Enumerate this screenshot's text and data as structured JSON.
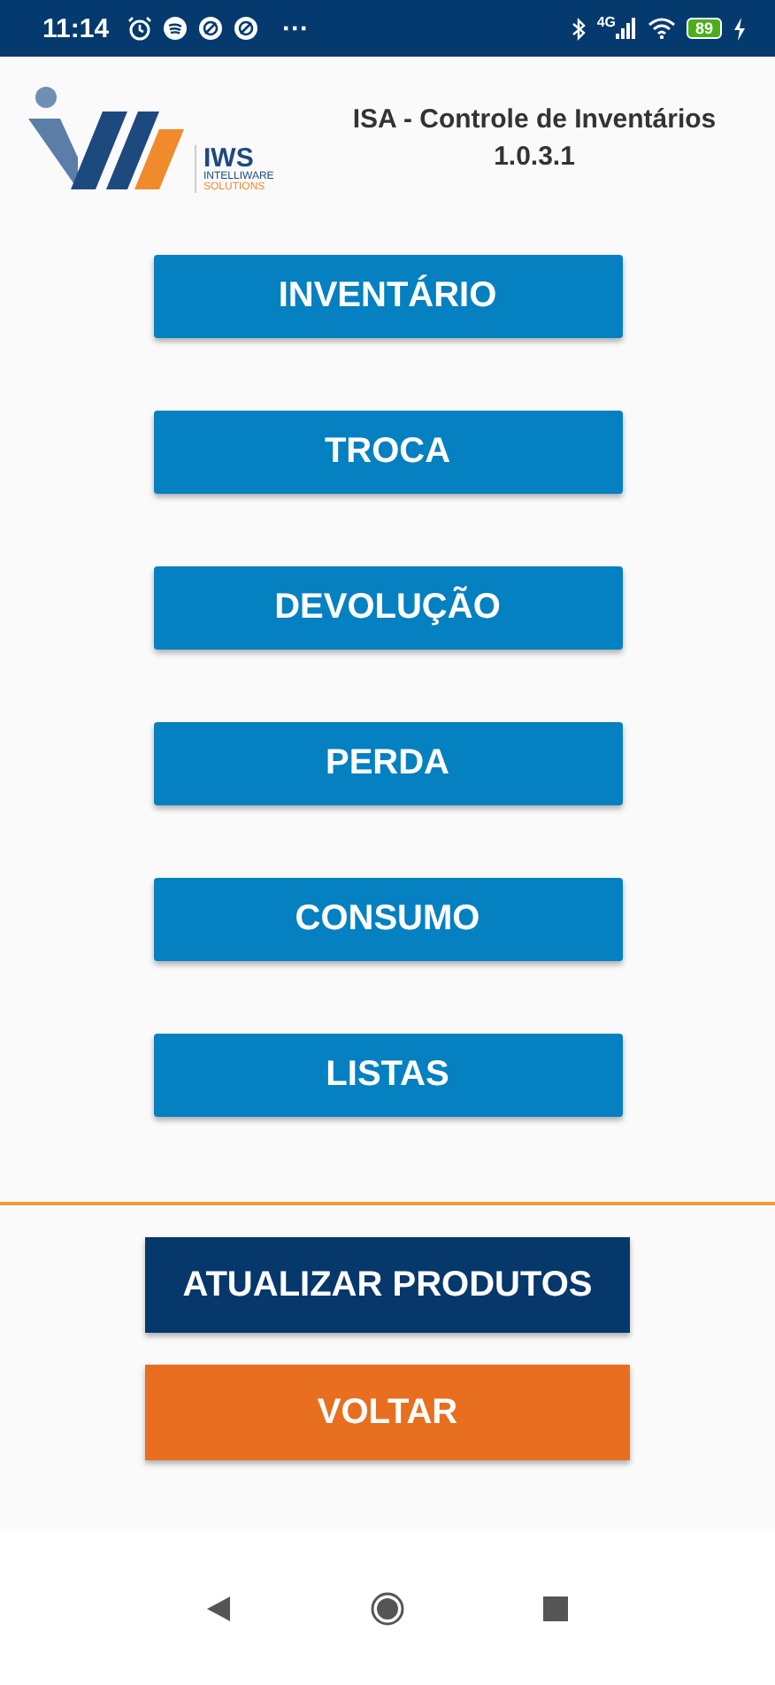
{
  "status_bar": {
    "time": "11:14",
    "more": "···",
    "network": "4G",
    "battery": "89"
  },
  "header": {
    "logo": {
      "name": "IWS",
      "line1": "INTELLIWARE",
      "line2": "SOLUTIONS"
    },
    "title": "ISA - Controle de Inventários",
    "version": "1.0.3.1"
  },
  "menu": [
    {
      "label": "INVENTÁRIO"
    },
    {
      "label": "TROCA"
    },
    {
      "label": "DEVOLUÇÃO"
    },
    {
      "label": "PERDA"
    },
    {
      "label": "CONSUMO"
    },
    {
      "label": "LISTAS"
    }
  ],
  "footer_buttons": [
    {
      "label": "ATUALIZAR PRODUTOS",
      "kind": "primary"
    },
    {
      "label": "VOLTAR",
      "kind": "back"
    }
  ]
}
